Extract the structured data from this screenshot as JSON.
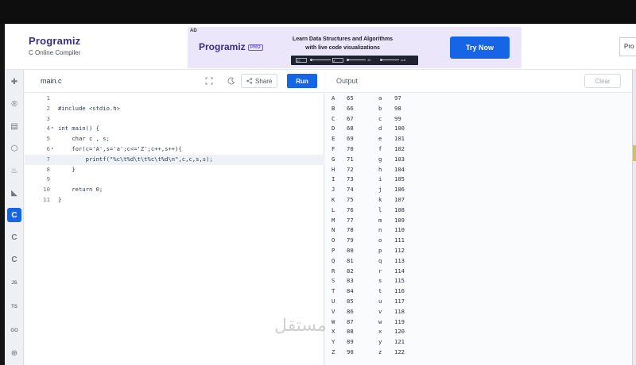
{
  "header": {
    "brand": "Programiz",
    "subtitle": "C Online Compiler",
    "pro_button": "Pro"
  },
  "ad": {
    "tag": "AD",
    "logo": "Programiz",
    "pro_badge": "PRO",
    "headline_line1": "Learn Data Structures and Algorithms",
    "headline_line2": "with live code visualizations",
    "cta": "Try Now",
    "strip_nodes": [
      "22",
      "4",
      "40",
      "null"
    ]
  },
  "rail": {
    "items": [
      {
        "icon": "python-icon",
        "glyph": "✚"
      },
      {
        "icon": "r-icon",
        "glyph": "®"
      },
      {
        "icon": "sql-icon",
        "glyph": "▤"
      },
      {
        "icon": "html-icon",
        "glyph": "⬡"
      },
      {
        "icon": "java-icon",
        "glyph": "♨"
      },
      {
        "icon": "kotlin-icon",
        "glyph": "◣"
      },
      {
        "icon": "c-icon",
        "glyph": "C"
      },
      {
        "icon": "cpp-icon",
        "glyph": "C"
      },
      {
        "icon": "csharp-icon",
        "glyph": "C"
      },
      {
        "icon": "js-icon",
        "glyph": "JS"
      },
      {
        "icon": "ts-icon",
        "glyph": "TS"
      },
      {
        "icon": "go-icon",
        "glyph": "GO"
      },
      {
        "icon": "php-icon",
        "glyph": "⊕"
      }
    ]
  },
  "editor": {
    "file_tab": "main.c",
    "share_label": "Share",
    "run_label": "Run",
    "lines": [
      {
        "n": "1",
        "text": ""
      },
      {
        "n": "2",
        "text": "#include <stdio.h>"
      },
      {
        "n": "3",
        "text": ""
      },
      {
        "n": "4",
        "text": "int main() {"
      },
      {
        "n": "5",
        "text": "    char c , s;"
      },
      {
        "n": "6",
        "text": "    for(c='A',s='a';c<='Z';c++,s++){"
      },
      {
        "n": "7",
        "text": "        printf(\"%c\\t%d\\t\\t%c\\t%d\\n\",c,c,s,s);"
      },
      {
        "n": "8",
        "text": "    }"
      },
      {
        "n": "9",
        "text": ""
      },
      {
        "n": "10",
        "text": "    return 0;"
      },
      {
        "n": "11",
        "text": "}"
      }
    ]
  },
  "output": {
    "title": "Output",
    "clear_label": "Clear",
    "rows": [
      [
        "A",
        "65",
        "a",
        "97"
      ],
      [
        "B",
        "66",
        "b",
        "98"
      ],
      [
        "C",
        "67",
        "c",
        "99"
      ],
      [
        "D",
        "68",
        "d",
        "100"
      ],
      [
        "E",
        "69",
        "e",
        "101"
      ],
      [
        "F",
        "70",
        "f",
        "102"
      ],
      [
        "G",
        "71",
        "g",
        "103"
      ],
      [
        "H",
        "72",
        "h",
        "104"
      ],
      [
        "I",
        "73",
        "i",
        "105"
      ],
      [
        "J",
        "74",
        "j",
        "106"
      ],
      [
        "K",
        "75",
        "k",
        "107"
      ],
      [
        "L",
        "76",
        "l",
        "108"
      ],
      [
        "M",
        "77",
        "m",
        "109"
      ],
      [
        "N",
        "78",
        "n",
        "110"
      ],
      [
        "O",
        "79",
        "o",
        "111"
      ],
      [
        "P",
        "80",
        "p",
        "112"
      ],
      [
        "Q",
        "81",
        "q",
        "113"
      ],
      [
        "R",
        "82",
        "r",
        "114"
      ],
      [
        "S",
        "83",
        "s",
        "115"
      ],
      [
        "T",
        "84",
        "t",
        "116"
      ],
      [
        "U",
        "85",
        "u",
        "117"
      ],
      [
        "V",
        "86",
        "v",
        "118"
      ],
      [
        "W",
        "87",
        "w",
        "119"
      ],
      [
        "X",
        "88",
        "x",
        "120"
      ],
      [
        "Y",
        "89",
        "y",
        "121"
      ],
      [
        "Z",
        "90",
        "z",
        "122"
      ]
    ]
  },
  "watermark": "مستقل",
  "colors": {
    "accent": "#1565e6",
    "brand": "#3b2d86",
    "ad_background": "#ece6fb"
  }
}
